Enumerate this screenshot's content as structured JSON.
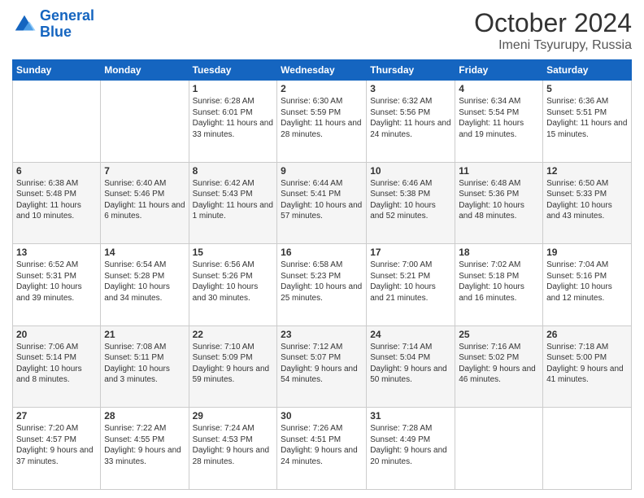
{
  "header": {
    "logo_line1": "General",
    "logo_line2": "Blue",
    "month": "October 2024",
    "location": "Imeni Tsyurupy, Russia"
  },
  "weekdays": [
    "Sunday",
    "Monday",
    "Tuesday",
    "Wednesday",
    "Thursday",
    "Friday",
    "Saturday"
  ],
  "weeks": [
    [
      {
        "day": "",
        "sunrise": "",
        "sunset": "",
        "daylight": ""
      },
      {
        "day": "",
        "sunrise": "",
        "sunset": "",
        "daylight": ""
      },
      {
        "day": "1",
        "sunrise": "Sunrise: 6:28 AM",
        "sunset": "Sunset: 6:01 PM",
        "daylight": "Daylight: 11 hours and 33 minutes."
      },
      {
        "day": "2",
        "sunrise": "Sunrise: 6:30 AM",
        "sunset": "Sunset: 5:59 PM",
        "daylight": "Daylight: 11 hours and 28 minutes."
      },
      {
        "day": "3",
        "sunrise": "Sunrise: 6:32 AM",
        "sunset": "Sunset: 5:56 PM",
        "daylight": "Daylight: 11 hours and 24 minutes."
      },
      {
        "day": "4",
        "sunrise": "Sunrise: 6:34 AM",
        "sunset": "Sunset: 5:54 PM",
        "daylight": "Daylight: 11 hours and 19 minutes."
      },
      {
        "day": "5",
        "sunrise": "Sunrise: 6:36 AM",
        "sunset": "Sunset: 5:51 PM",
        "daylight": "Daylight: 11 hours and 15 minutes."
      }
    ],
    [
      {
        "day": "6",
        "sunrise": "Sunrise: 6:38 AM",
        "sunset": "Sunset: 5:48 PM",
        "daylight": "Daylight: 11 hours and 10 minutes."
      },
      {
        "day": "7",
        "sunrise": "Sunrise: 6:40 AM",
        "sunset": "Sunset: 5:46 PM",
        "daylight": "Daylight: 11 hours and 6 minutes."
      },
      {
        "day": "8",
        "sunrise": "Sunrise: 6:42 AM",
        "sunset": "Sunset: 5:43 PM",
        "daylight": "Daylight: 11 hours and 1 minute."
      },
      {
        "day": "9",
        "sunrise": "Sunrise: 6:44 AM",
        "sunset": "Sunset: 5:41 PM",
        "daylight": "Daylight: 10 hours and 57 minutes."
      },
      {
        "day": "10",
        "sunrise": "Sunrise: 6:46 AM",
        "sunset": "Sunset: 5:38 PM",
        "daylight": "Daylight: 10 hours and 52 minutes."
      },
      {
        "day": "11",
        "sunrise": "Sunrise: 6:48 AM",
        "sunset": "Sunset: 5:36 PM",
        "daylight": "Daylight: 10 hours and 48 minutes."
      },
      {
        "day": "12",
        "sunrise": "Sunrise: 6:50 AM",
        "sunset": "Sunset: 5:33 PM",
        "daylight": "Daylight: 10 hours and 43 minutes."
      }
    ],
    [
      {
        "day": "13",
        "sunrise": "Sunrise: 6:52 AM",
        "sunset": "Sunset: 5:31 PM",
        "daylight": "Daylight: 10 hours and 39 minutes."
      },
      {
        "day": "14",
        "sunrise": "Sunrise: 6:54 AM",
        "sunset": "Sunset: 5:28 PM",
        "daylight": "Daylight: 10 hours and 34 minutes."
      },
      {
        "day": "15",
        "sunrise": "Sunrise: 6:56 AM",
        "sunset": "Sunset: 5:26 PM",
        "daylight": "Daylight: 10 hours and 30 minutes."
      },
      {
        "day": "16",
        "sunrise": "Sunrise: 6:58 AM",
        "sunset": "Sunset: 5:23 PM",
        "daylight": "Daylight: 10 hours and 25 minutes."
      },
      {
        "day": "17",
        "sunrise": "Sunrise: 7:00 AM",
        "sunset": "Sunset: 5:21 PM",
        "daylight": "Daylight: 10 hours and 21 minutes."
      },
      {
        "day": "18",
        "sunrise": "Sunrise: 7:02 AM",
        "sunset": "Sunset: 5:18 PM",
        "daylight": "Daylight: 10 hours and 16 minutes."
      },
      {
        "day": "19",
        "sunrise": "Sunrise: 7:04 AM",
        "sunset": "Sunset: 5:16 PM",
        "daylight": "Daylight: 10 hours and 12 minutes."
      }
    ],
    [
      {
        "day": "20",
        "sunrise": "Sunrise: 7:06 AM",
        "sunset": "Sunset: 5:14 PM",
        "daylight": "Daylight: 10 hours and 8 minutes."
      },
      {
        "day": "21",
        "sunrise": "Sunrise: 7:08 AM",
        "sunset": "Sunset: 5:11 PM",
        "daylight": "Daylight: 10 hours and 3 minutes."
      },
      {
        "day": "22",
        "sunrise": "Sunrise: 7:10 AM",
        "sunset": "Sunset: 5:09 PM",
        "daylight": "Daylight: 9 hours and 59 minutes."
      },
      {
        "day": "23",
        "sunrise": "Sunrise: 7:12 AM",
        "sunset": "Sunset: 5:07 PM",
        "daylight": "Daylight: 9 hours and 54 minutes."
      },
      {
        "day": "24",
        "sunrise": "Sunrise: 7:14 AM",
        "sunset": "Sunset: 5:04 PM",
        "daylight": "Daylight: 9 hours and 50 minutes."
      },
      {
        "day": "25",
        "sunrise": "Sunrise: 7:16 AM",
        "sunset": "Sunset: 5:02 PM",
        "daylight": "Daylight: 9 hours and 46 minutes."
      },
      {
        "day": "26",
        "sunrise": "Sunrise: 7:18 AM",
        "sunset": "Sunset: 5:00 PM",
        "daylight": "Daylight: 9 hours and 41 minutes."
      }
    ],
    [
      {
        "day": "27",
        "sunrise": "Sunrise: 7:20 AM",
        "sunset": "Sunset: 4:57 PM",
        "daylight": "Daylight: 9 hours and 37 minutes."
      },
      {
        "day": "28",
        "sunrise": "Sunrise: 7:22 AM",
        "sunset": "Sunset: 4:55 PM",
        "daylight": "Daylight: 9 hours and 33 minutes."
      },
      {
        "day": "29",
        "sunrise": "Sunrise: 7:24 AM",
        "sunset": "Sunset: 4:53 PM",
        "daylight": "Daylight: 9 hours and 28 minutes."
      },
      {
        "day": "30",
        "sunrise": "Sunrise: 7:26 AM",
        "sunset": "Sunset: 4:51 PM",
        "daylight": "Daylight: 9 hours and 24 minutes."
      },
      {
        "day": "31",
        "sunrise": "Sunrise: 7:28 AM",
        "sunset": "Sunset: 4:49 PM",
        "daylight": "Daylight: 9 hours and 20 minutes."
      },
      {
        "day": "",
        "sunrise": "",
        "sunset": "",
        "daylight": ""
      },
      {
        "day": "",
        "sunrise": "",
        "sunset": "",
        "daylight": ""
      }
    ]
  ]
}
